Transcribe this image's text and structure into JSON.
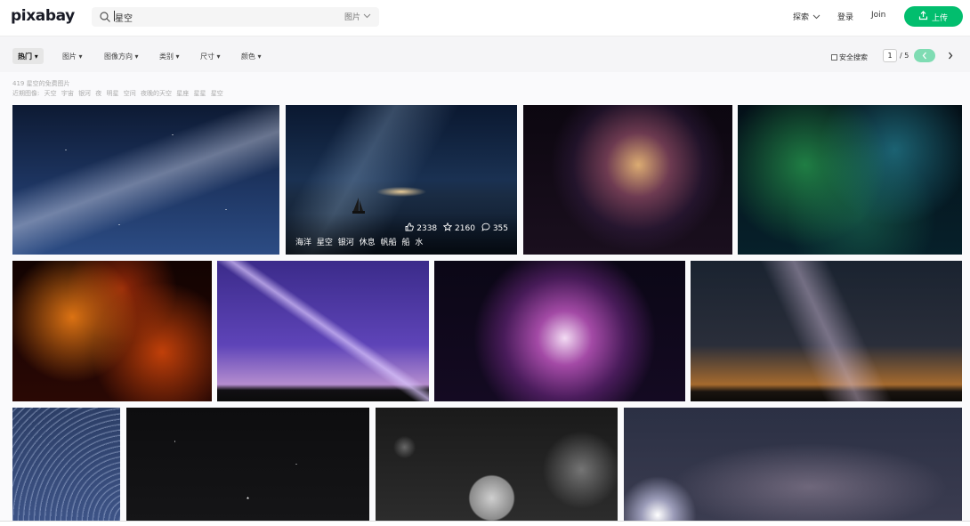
{
  "header": {
    "logo": "pixabay",
    "search": {
      "value": "星空",
      "type_label": "图片"
    },
    "nav": {
      "explore": "探索",
      "login": "登录",
      "join": "Join"
    },
    "upload_label": "上传",
    "colors": {
      "brand": "#02be6e"
    }
  },
  "filters": {
    "items": [
      "热门",
      "图片",
      "图像方向",
      "类别",
      "尺寸",
      "颜色"
    ],
    "safe_search": "安全搜索",
    "page_current": "1",
    "page_total": "/ 5"
  },
  "results": {
    "count_text": "419 星空的免费图片",
    "related_label": "近期图像:",
    "related_tags": [
      "天空",
      "宇宙",
      "银河",
      "夜",
      "明星",
      "空间",
      "夜晚的天空",
      "星座",
      "星星",
      "星空"
    ],
    "hovered_photo": {
      "likes": "2338",
      "favorites": "2160",
      "comments": "355",
      "tags": [
        "海洋",
        "星空",
        "银河",
        "休息",
        "帆船",
        "船",
        "水"
      ]
    }
  }
}
